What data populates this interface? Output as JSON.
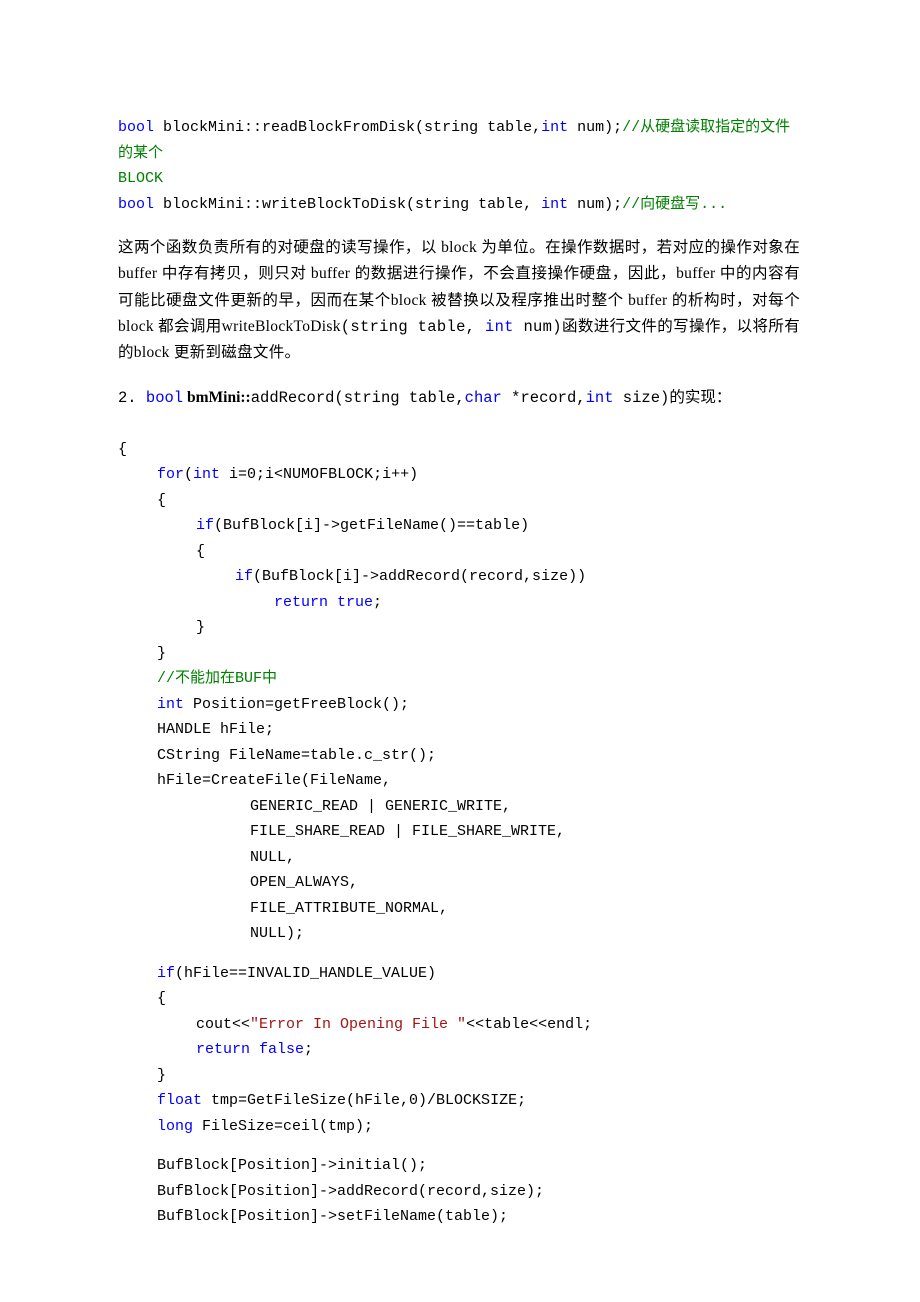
{
  "topcode": {
    "l1a": "bool",
    "l1b": " blockMini::readBlockFromDisk(string table,",
    "l1c": "int",
    "l1d": " num);",
    "l1e": "//从硬盘读取指定的文件的某个",
    "l2": "BLOCK",
    "l3a": "bool",
    "l3b": " blockMini::writeBlockToDisk(string table, ",
    "l3c": "int",
    "l3d": " num);",
    "l3e": "//向硬盘写..."
  },
  "para": {
    "p1": "这两个函数负责所有的对硬盘的读写操作，以 block 为单位。在操作数据时，若对应的操作对象在 buffer 中存有拷贝，则只对 buffer 的数据进行操作，不会直接操作硬盘，因此，buffer 中的内容有可能比硬盘文件更新的早，因而在某个block 被替换以及程序推出时整个 buffer 的析构时，对每个 block 都会调用writeBlockToDisk",
    "p1tail_a": "(string table, ",
    "p1tail_int": "int",
    "p1tail_b": " num)",
    "p1tail_c": "函数进行文件的写操作，以将所有的block 更新到磁盘文件。"
  },
  "head": {
    "num": "2. ",
    "bool": "bool",
    "cls": " bmMini::",
    "fn": "addRecord(string table,",
    "char": "char",
    "mid": " *record,",
    "int": "int",
    "tail": " size)",
    "cn": "的实现："
  },
  "code": {
    "obr": "{",
    "for_kw": "for",
    "for_rest_a": "(",
    "for_int": "int",
    "for_rest_b": " i=0;i<NUMOFBLOCK;i++)",
    "ob": "{",
    "if1_kw": "if",
    "if1_rest": "(BufBlock[i]->getFileName()==table)",
    "if2_kw": "if",
    "if2_rest": "(BufBlock[i]->addRecord(record,size))",
    "ret_true_a": "return",
    "ret_true_b": " true",
    "ret_true_c": ";",
    "cb": "}",
    "cmt": "//不能加在BUF中",
    "int_pos_a": "int",
    "int_pos_b": " Position=getFreeBlock();",
    "handle": "HANDLE hFile;",
    "cstring": "CString FileName=table.c_str();",
    "create": "hFile=CreateFile(FileName,",
    "arg1": "GENERIC_READ | GENERIC_WRITE,",
    "arg2": "FILE_SHARE_READ | FILE_SHARE_WRITE,",
    "arg3": "NULL,",
    "arg4": "OPEN_ALWAYS,",
    "arg5": "FILE_ATTRIBUTE_NORMAL,",
    "arg6": "NULL);",
    "ifinv_kw": "if",
    "ifinv_rest": "(hFile==INVALID_HANDLE_VALUE)",
    "cout_a": "cout<<",
    "cout_str": "\"Error In Opening File \"",
    "cout_b": "<<table<<endl;",
    "ret_false_a": "return",
    "ret_false_b": " false",
    "ret_false_c": ";",
    "float_kw": "float",
    "float_rest": " tmp=GetFileSize(hFile,0)/BLOCKSIZE;",
    "long_kw": "long",
    "long_rest": " FileSize=ceil(tmp);",
    "bb1": "BufBlock[Position]->initial();",
    "bb2": "BufBlock[Position]->addRecord(record,size);",
    "bb3": "BufBlock[Position]->setFileName(table);"
  }
}
